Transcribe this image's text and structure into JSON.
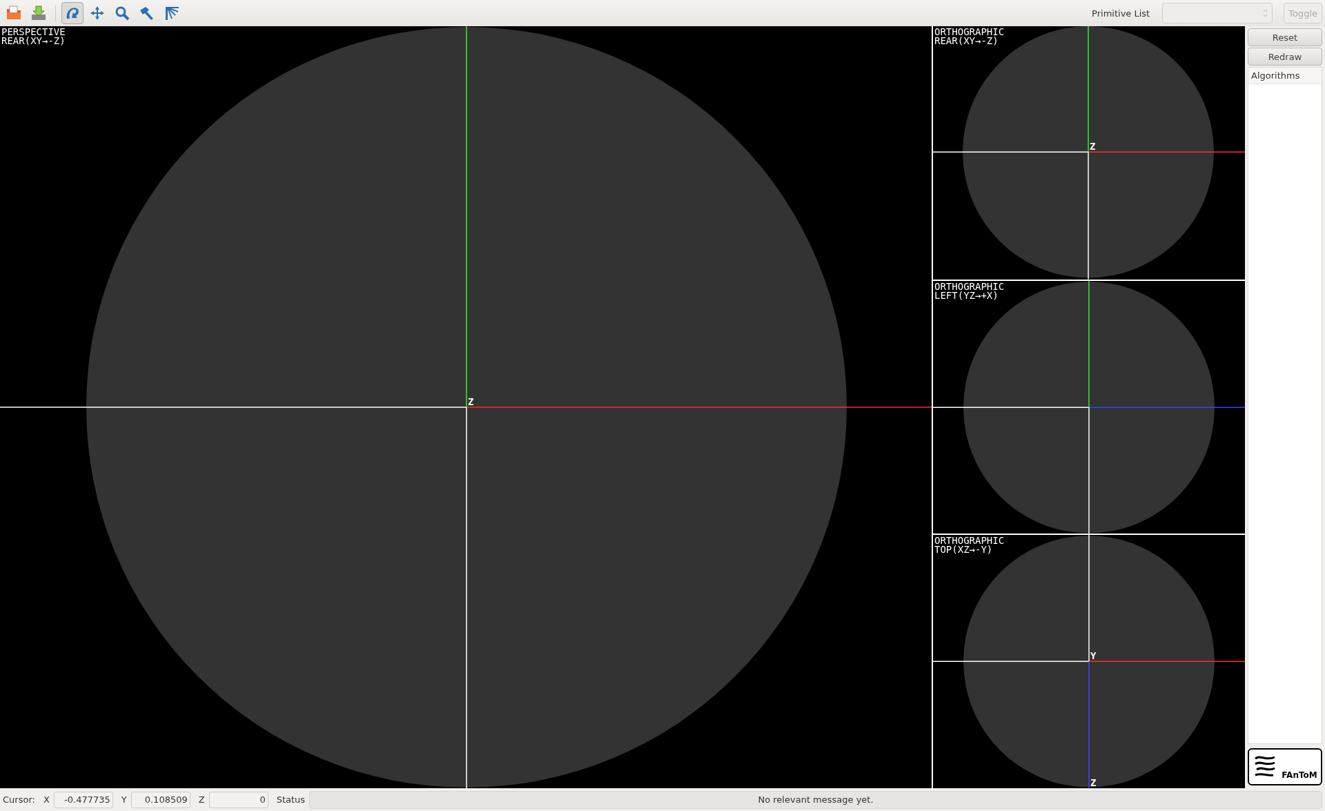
{
  "toolbar": {
    "tools": [
      {
        "kind": "open",
        "selected": false
      },
      {
        "kind": "save",
        "selected": false
      },
      {
        "kind": "rotate",
        "selected": true
      },
      {
        "kind": "move",
        "selected": false
      },
      {
        "kind": "zoom",
        "selected": false
      },
      {
        "kind": "pick",
        "selected": false
      },
      {
        "kind": "light",
        "selected": false
      }
    ],
    "primitive_list": {
      "label": "Primitive List",
      "disabled": true
    },
    "toggle": {
      "label": "Toggle",
      "disabled": true
    }
  },
  "viewports": [
    {
      "kind": "rear",
      "projection": "PERSPECTIVE",
      "view": "REAR(XY→-Z)",
      "axis_labels": [
        {
          "text": "Z",
          "kind": "origin"
        }
      ]
    },
    {
      "kind": "rear",
      "projection": "ORTHOGRAPHIC",
      "view": "REAR(XY→-Z)",
      "axis_labels": [
        {
          "text": "Z",
          "kind": "origin"
        }
      ]
    },
    {
      "kind": "left",
      "projection": "ORTHOGRAPHIC",
      "view": "LEFT(YZ→+X)"
    },
    {
      "kind": "top",
      "projection": "ORTHOGRAPHIC",
      "view": "TOP(XZ→-Y)",
      "axis_labels": [
        {
          "text": "Y",
          "kind": "origin"
        },
        {
          "text": "Z",
          "kind": "end"
        }
      ]
    }
  ],
  "side_panel": {
    "buttons": [
      "Reset",
      "Redraw"
    ],
    "list_header": "Algorithms",
    "logo": "FAnToM"
  },
  "status_bar": {
    "cursor_label": "Cursor:",
    "coords": [
      {
        "label": "X",
        "value": "-0.477735"
      },
      {
        "label": "Y",
        "value": "0.108509"
      },
      {
        "label": "Z",
        "value": "0"
      }
    ],
    "status_label": "Status",
    "message": "No relevant message yet."
  }
}
